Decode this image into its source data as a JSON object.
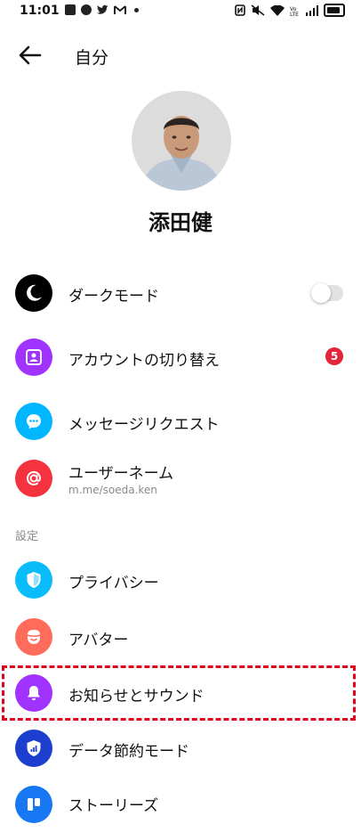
{
  "status_bar": {
    "time": "11:01",
    "left_icons": [
      "line-icon",
      "chrome-icon",
      "twitter-icon",
      "gmail-icon",
      "dot-icon"
    ],
    "right_icons": [
      "nfc-icon",
      "mute-icon",
      "wifi-icon",
      "volte-icon",
      "signal-icon",
      "battery-icon"
    ]
  },
  "header": {
    "title": "自分",
    "back_icon": "arrow-left-icon"
  },
  "profile": {
    "name": "添田健",
    "avatar_icon": "user-photo"
  },
  "menu_items": [
    {
      "label": "ダークモード",
      "icon": "moon-icon",
      "icon_bg": "#000000",
      "toggle_on": false
    },
    {
      "label": "アカウントの切り替え",
      "icon": "switch-account-icon",
      "icon_bg": "#a033ff",
      "badge": "5"
    },
    {
      "label": "メッセージリクエスト",
      "icon": "chat-bubble-icon",
      "icon_bg": "#00b6ff"
    },
    {
      "label": "ユーザーネーム",
      "sublabel": "m.me/soeda.ken",
      "icon": "at-icon",
      "icon_bg": "#f5333f"
    }
  ],
  "settings": {
    "section_label": "設定",
    "items": [
      {
        "label": "プライバシー",
        "icon": "shield-icon",
        "icon_bg": "#0abcfa"
      },
      {
        "label": "アバター",
        "icon": "avatar-face-icon",
        "icon_bg": "#ff6c5c"
      },
      {
        "label": "お知らせとサウンド",
        "icon": "bell-icon",
        "icon_bg": "#a033ff"
      },
      {
        "label": "データ節約モード",
        "icon": "data-saver-icon",
        "icon_bg": "#1d3fcf"
      },
      {
        "label": "ストーリーズ",
        "icon": "stories-icon",
        "icon_bg": "#1877f2"
      }
    ]
  },
  "colors": {
    "highlight_border": "#e0001b",
    "badge": "#e4253a"
  }
}
